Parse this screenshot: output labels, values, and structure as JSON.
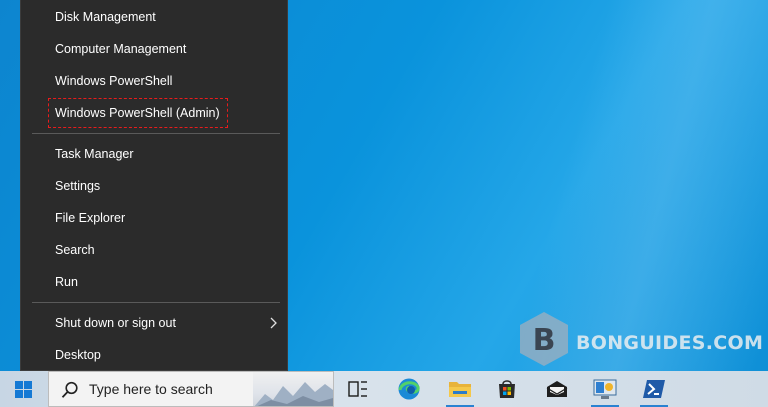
{
  "menu": {
    "items": [
      {
        "label": "Disk Management"
      },
      {
        "label": "Computer Management"
      },
      {
        "label": "Windows PowerShell"
      },
      {
        "label": "Windows PowerShell (Admin)"
      },
      {
        "label": "Task Manager"
      },
      {
        "label": "Settings"
      },
      {
        "label": "File Explorer"
      },
      {
        "label": "Search"
      },
      {
        "label": "Run"
      },
      {
        "label": "Shut down or sign out"
      },
      {
        "label": "Desktop"
      }
    ],
    "highlighted_item": "Windows PowerShell (Admin)"
  },
  "watermark": {
    "text": "BONGUIDES.COM"
  },
  "taskbar": {
    "search_placeholder": "Type here to search",
    "pinned": [
      {
        "icon": "task-view-icon"
      },
      {
        "icon": "edge-icon"
      },
      {
        "icon": "file-explorer-icon"
      },
      {
        "icon": "microsoft-store-icon"
      },
      {
        "icon": "mail-icon"
      },
      {
        "icon": "control-panel-icon"
      },
      {
        "icon": "powershell-icon"
      }
    ]
  },
  "colors": {
    "menu_bg": "#2b2b2b",
    "highlight_border": "#e81c1c",
    "desktop_blue": "#0a8fd8",
    "taskbar_bg": "#d4dfe8"
  }
}
